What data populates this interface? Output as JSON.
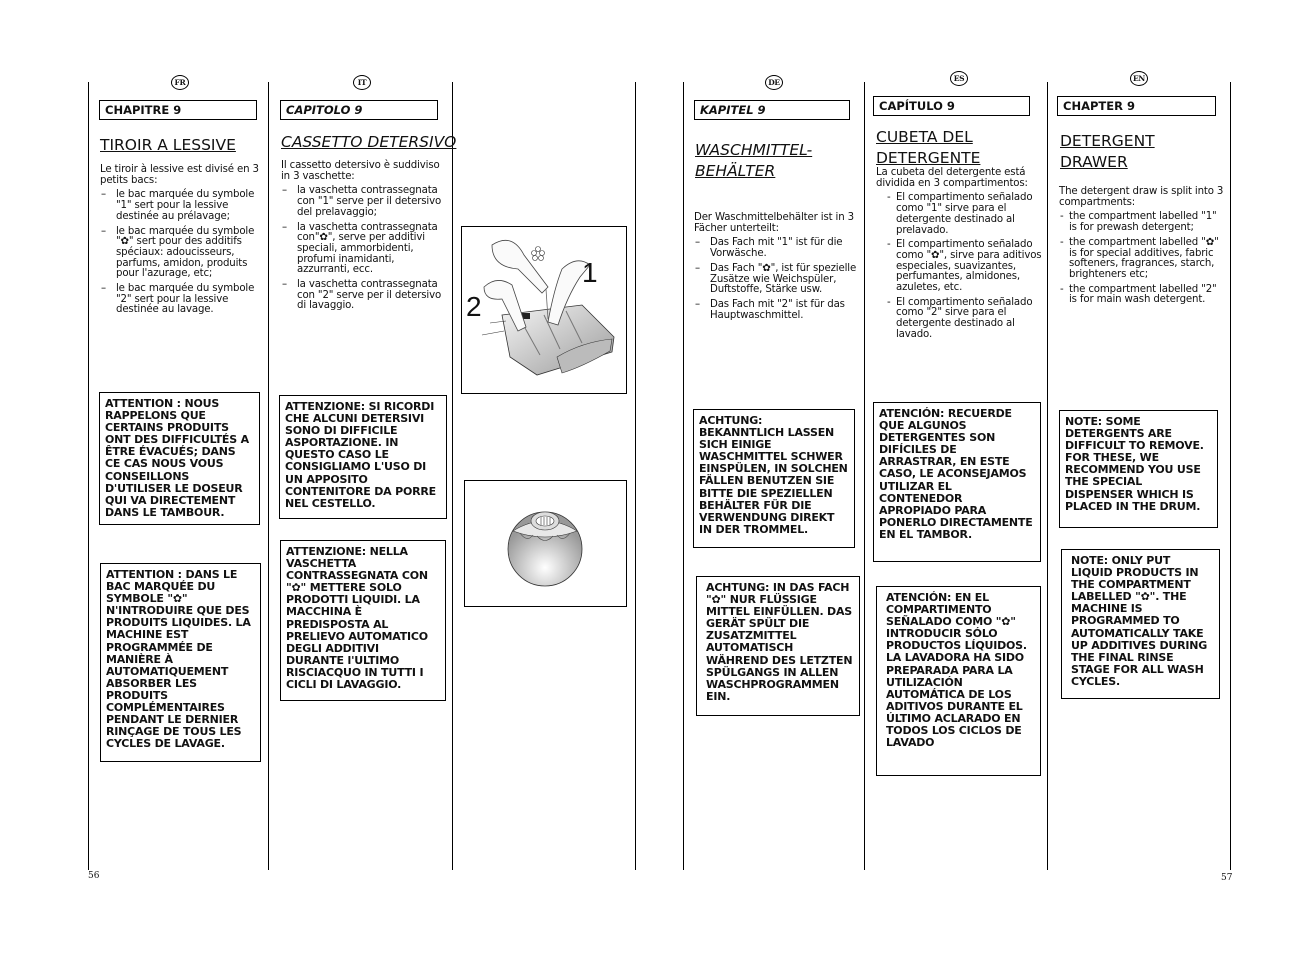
{
  "pages": {
    "left_number": "56",
    "right_number": "57"
  },
  "columns": {
    "fr": {
      "badge": "FR",
      "chapter": "CHAPITRE 9",
      "title": "TIROIR A LESSIVE",
      "intro": "Le tiroir à lessive est divisé en 3 petits bacs:",
      "items": [
        "le bac marquée du symbole \"1\" sert pour la lessive destinée au prélavage;",
        "le bac marquée du symbole \"✿\" sert pour des additifs spéciaux: adoucisseurs, parfums, amidon, produits pour l'azurage, etc;",
        "le bac marquée du symbole \"2\" sert pour la lessive destinée au lavage."
      ],
      "note1": "ATTENTION : NOUS RAPPELONS QUE CERTAINS PRODUITS ONT DES DIFFICULTÉS A ÊTRE ÉVACUÉS; DANS CE CAS NOUS VOUS CONSEILLONS D'UTILISER LE DOSEUR QUI VA DIRECTEMENT DANS LE TAMBOUR.",
      "note2": "ATTENTION : DANS LE BAC MARQUÉE DU SYMBOLE \"✿\" N'INTRODUIRE QUE DES PRODUITS LIQUIDES. LA MACHINE EST PROGRAMMÉE DE MANIÈRE À AUTOMATIQUEMENT ABSORBER LES PRODUITS COMPLÉMENTAIRES PENDANT LE DERNIER RINÇAGE DE TOUS LES CYCLES DE LAVAGE."
    },
    "it": {
      "badge": "IT",
      "chapter": "CAPITOLO 9",
      "title": "CASSETTO DETERSIVO",
      "intro": "Il cassetto detersivo è suddiviso in 3 vaschette:",
      "items": [
        "la vaschetta contrassegnata con \"1\" serve per il detersivo del prelavaggio;",
        "la vaschetta contrassegnata con\"✿\", serve per additivi speciali, ammorbidenti, profumi inamidanti, azzurranti, ecc.",
        "la vaschetta contrassegnata con \"2\" serve per il detersivo di lavaggio."
      ],
      "note1": "ATTENZIONE: SI RICORDI CHE ALCUNI DETERSIVI SONO DI DIFFICILE ASPORTAZIONE. IN QUESTO CASO LE CONSIGLIAMO L'USO DI UN APPOSITO CONTENITORE DA PORRE NEL CESTELLO.",
      "note2": "ATTENZIONE: NELLA VASCHETTA CONTRASSEGNATA CON \"✿\" METTERE SOLO PRODOTTI LIQUIDI. LA MACCHINA È PREDISPOSTA AL PRELIEVO AUTOMATICO DEGLI ADDITIVI DURANTE l'ULTIMO RISCIACQUO IN TUTTI I CICLI DI LAVAGGIO."
    },
    "figures": {
      "drawer_labels": [
        "1",
        "2"
      ],
      "drawer_icon": "flower-symbol-icon",
      "dispenser_icon": "dosing-ball-icon"
    },
    "de": {
      "badge": "DE",
      "chapter": "KAPITEL 9",
      "title_line1": "WASCHMITTEL-",
      "title_line2": "BEHÄLTER",
      "intro": "Der Waschmittelbehälter ist in 3 Fächer unterteilt:",
      "items": [
        "Das Fach mit \"1\" ist für die Vorwäsche.",
        "Das Fach \"✿\", ist für spezielle Zusätze wie Weichspüler, Duftstoffe, Stärke usw.",
        "Das Fach mit \"2\" ist für das Hauptwaschmittel."
      ],
      "note1": "ACHTUNG: BEKANNTLICH LASSEN SICH EINIGE WASCHMITTEL SCHWER EINSPÜLEN, IN SOLCHEN FÄLLEN BENUTZEN SIE BITTE DIE SPEZIELLEN BEHÄLTER FÜR DIE VERWENDUNG DIREKT IN DER TROMMEL.",
      "note2": "ACHTUNG: IN DAS FACH \"✿\" NUR FLÜSSIGE MITTEL EINFÜLLEN. DAS GERÄT SPÜLT DIE ZUSATZMITTEL AUTOMATISCH WÄHREND DES LETZTEN SPÜLGANGS IN ALLEN WASCHPROGRAMMEN EIN."
    },
    "es": {
      "badge": "ES",
      "chapter": "CAPÍTULO 9",
      "title_line1": "CUBETA DEL",
      "title_line2": "DETERGENTE",
      "intro": "La cubeta del detergente está dividida en 3 compartimentos:",
      "items": [
        "El compartimento señalado como \"1\" sirve para el detergente destinado al prelavado.",
        "El compartimento señalado como \"✿\", sirve para aditivos especiales, suavizantes, perfumantes, almidones, azuletes, etc.",
        "El compartimento señalado como \"2\" sirve para el detergente destinado al lavado."
      ],
      "note1": "ATENCIÓN: RECUERDE QUE ALGUNOS DETERGENTES SON DIFÍCILES DE ARRASTRAR, EN ESTE CASO, LE ACONSEJAMOS UTILIZAR EL CONTENEDOR APROPIADO PARA PONERLO DIRECTAMENTE EN EL TAMBOR.",
      "note2": "ATENCIÓN: EN EL COMPARTIMENTO SEÑALADO COMO \"✿\" INTRODUCIR SÓLO PRODUCTOS LÍQUIDOS. LA LAVADORA HA SIDO PREPARADA PARA LA UTILIZACIÓN AUTOMÁTICA DE LOS ADITIVOS DURANTE EL ÚLTIMO ACLARADO EN TODOS LOS CICLOS DE LAVADO"
    },
    "en": {
      "badge": "EN",
      "chapter": "CHAPTER 9",
      "title_line1": "DETERGENT",
      "title_line2": "DRAWER",
      "intro": "The detergent draw is split into 3 compartments:",
      "items": [
        "the compartment labelled \"1\" is for prewash detergent;",
        "the compartment labelled \"✿\" is for special additives, fabric softeners, fragrances, starch, brighteners etc;",
        "the compartment labelled \"2\" is for main wash detergent."
      ],
      "note1": "NOTE: SOME DETERGENTS ARE DIFFICULT TO REMOVE. FOR THESE, WE RECOMMEND YOU USE THE SPECIAL DISPENSER WHICH IS PLACED IN THE DRUM.",
      "note2": "NOTE: ONLY PUT LIQUID PRODUCTS IN THE COMPARTMENT LABELLED \"✿\". THE MACHINE IS PROGRAMMED TO AUTOMATICALLY TAKE UP ADDITIVES DURING THE FINAL RINSE STAGE FOR ALL WASH CYCLES."
    }
  }
}
